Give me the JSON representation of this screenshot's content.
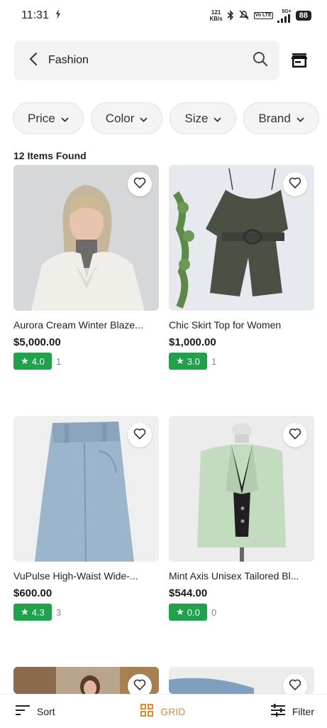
{
  "status_bar": {
    "time": "11:31",
    "net_speed_value": "121",
    "net_speed_unit": "KB/s",
    "volte": "Vo LTE",
    "network": "5G+",
    "battery": "88"
  },
  "search": {
    "query": "Fashion"
  },
  "filters": [
    {
      "label": "Price"
    },
    {
      "label": "Color"
    },
    {
      "label": "Size"
    },
    {
      "label": "Brand"
    }
  ],
  "results": {
    "count_text": "12 Items Found"
  },
  "products": [
    {
      "name": "Aurora Cream Winter Blaze...",
      "price": "$5,000.00",
      "rating": "4.0",
      "reviews": "1"
    },
    {
      "name": "Chic Skirt Top for Women",
      "price": "$1,000.00",
      "rating": "3.0",
      "reviews": "1"
    },
    {
      "name": "VuPulse High-Waist Wide-...",
      "price": "$600.00",
      "rating": "4.3",
      "reviews": "3"
    },
    {
      "name": "Mint Axis Unisex Tailored Bl...",
      "price": "$544.00",
      "rating": "0.0",
      "reviews": "0"
    }
  ],
  "bottom_bar": {
    "sort_label": "Sort",
    "grid_label": "GRID",
    "filter_label": "Filter"
  },
  "colors": {
    "accent": "#e58a2a",
    "rating_green": "#1fa34a"
  }
}
